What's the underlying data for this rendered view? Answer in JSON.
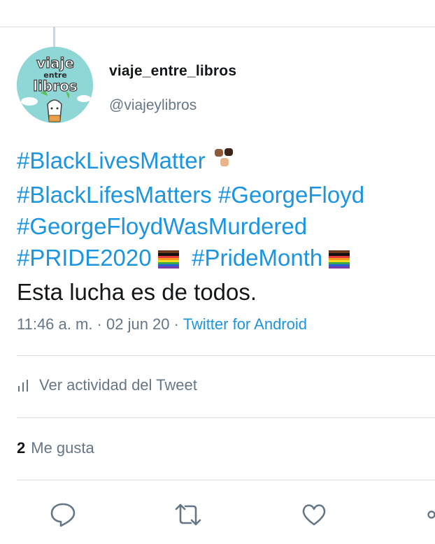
{
  "profile": {
    "display_name": "viaje_entre_libros",
    "handle": "@viajeylibros",
    "avatar_text": [
      "viaje",
      "entre",
      "libros"
    ]
  },
  "tweet": {
    "lines": [
      {
        "segments": [
          {
            "text": "#BlackLivesMatter",
            "type": "hashtag"
          },
          {
            "text": " ",
            "type": "text"
          },
          {
            "emoji": "raised-fists-icon"
          }
        ]
      },
      {
        "segments": [
          {
            "text": "#BlackLifesMatters",
            "type": "hashtag"
          },
          {
            "text": " ",
            "type": "text"
          },
          {
            "text": "#GeorgeFloyd",
            "type": "hashtag"
          }
        ]
      },
      {
        "segments": [
          {
            "text": "#GeorgeFloydWasMurdered",
            "type": "hashtag"
          }
        ]
      },
      {
        "segments": [
          {
            "text": "#PRIDE2020",
            "type": "hashtag"
          },
          {
            "text": " ",
            "type": "text"
          },
          {
            "emoji": "pride-flag-icon"
          },
          {
            "text": "  ",
            "type": "text"
          },
          {
            "text": "#PrideMonth",
            "type": "hashtag"
          },
          {
            "text": " ",
            "type": "text"
          },
          {
            "emoji": "pride-flag-icon"
          }
        ]
      },
      {
        "segments": [
          {
            "text": "Esta lucha es de todos.",
            "type": "text"
          }
        ]
      }
    ]
  },
  "meta": {
    "time": "11:46 a. m.",
    "separator": " · ",
    "date": "02 jun 20",
    "source": "Twitter for Android"
  },
  "activity": {
    "label": "Ver actividad del Tweet",
    "icon": "bar-chart-icon"
  },
  "likes": {
    "count": "2",
    "label": "Me gusta"
  },
  "actions": [
    {
      "name": "reply-icon"
    },
    {
      "name": "retweet-icon"
    },
    {
      "name": "like-icon"
    },
    {
      "name": "share-icon"
    }
  ],
  "colors": {
    "link": "#1b95e0",
    "secondary_text": "#657786",
    "divider": "#dcdfe2",
    "avatar_bg": "#8fd6d7"
  }
}
